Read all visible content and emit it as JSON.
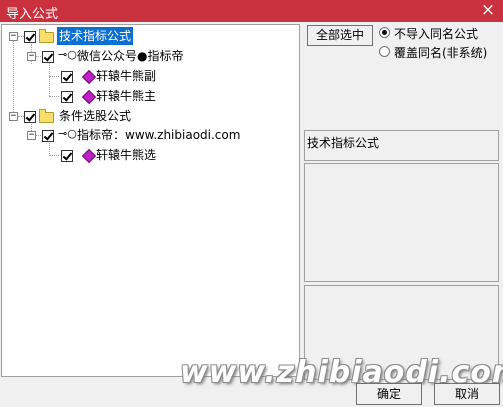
{
  "window": {
    "title": "导入公式",
    "close": "×"
  },
  "tree": {
    "root1": {
      "label": "技术指标公式"
    },
    "group1": {
      "label": "微信公众号●指标帝"
    },
    "item1": {
      "label": "轩辕牛熊副"
    },
    "item2": {
      "label": "轩辕牛熊主"
    },
    "root2": {
      "label": "条件选股公式"
    },
    "group2": {
      "label": "指标帝：www.zhibiaodi.com"
    },
    "item3": {
      "label": "轩辕牛熊选"
    },
    "expander": "−"
  },
  "right": {
    "select_all": "全部选中",
    "radio1": "不导入同名公式",
    "radio2": "覆盖同名(非系统)",
    "radio_selected": "radio1",
    "info_title": "技术指标公式"
  },
  "footer": {
    "ok": "确定",
    "cancel": "取消"
  },
  "watermark": "www.zhibiaodi.com",
  "colors": {
    "titlebar": "#c9313f",
    "selection": "#0b6fd0",
    "gem": "#c01fc9",
    "folder": "#f7de6b"
  }
}
